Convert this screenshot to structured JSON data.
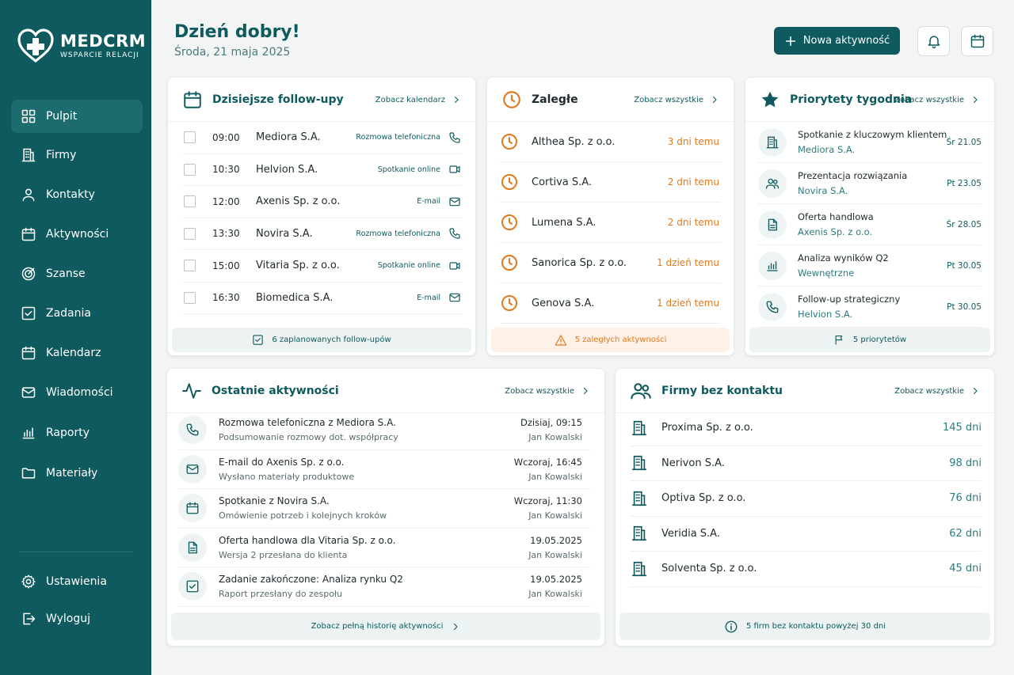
{
  "app": {
    "logo_title": "MEDCRM",
    "logo_subtitle": "WSPARCIE RELACJI",
    "brand_color": "#0e5a5e",
    "accent_orange": "#e07a1f"
  },
  "sidebar": {
    "items": [
      {
        "label": "Pulpit",
        "icon": "dashboard-icon"
      },
      {
        "label": "Firmy",
        "icon": "building-icon"
      },
      {
        "label": "Kontakty",
        "icon": "user-icon"
      },
      {
        "label": "Aktywności",
        "icon": "calendar-icon"
      },
      {
        "label": "Szanse",
        "icon": "target-icon"
      },
      {
        "label": "Zadania",
        "icon": "checkbox-icon"
      },
      {
        "label": "Kalendarz",
        "icon": "calendar-icon"
      },
      {
        "label": "Wiadomości",
        "icon": "mail-icon"
      },
      {
        "label": "Raporty",
        "icon": "bar-chart-icon"
      },
      {
        "label": "Materiały",
        "icon": "folder-icon"
      }
    ],
    "settings_label": "Ustawienia",
    "logout_label": "Wyloguj"
  },
  "header": {
    "greeting": "Dzień dobry!",
    "date": "Środa, 21 maja 2025",
    "new_activity_label": "Nowa aktywność"
  },
  "followups": {
    "title": "Dzisiejsze follow-upy",
    "link": "Zobacz kalendarz",
    "footer": "6 zaplanowanych follow-upów",
    "rows": [
      {
        "time": "09:00",
        "company": "Mediora S.A.",
        "type": "Rozmowa telefoniczna",
        "icon": "phone-icon"
      },
      {
        "time": "10:30",
        "company": "Helvion S.A.",
        "type": "Spotkanie online",
        "icon": "video-icon"
      },
      {
        "time": "12:00",
        "company": "Axenis Sp. z o.o.",
        "type": "E-mail",
        "icon": "mail-icon"
      },
      {
        "time": "13:30",
        "company": "Novira S.A.",
        "type": "Rozmowa telefoniczna",
        "icon": "phone-icon"
      },
      {
        "time": "15:00",
        "company": "Vitaria Sp. z o.o.",
        "type": "Spotkanie online",
        "icon": "video-icon"
      },
      {
        "time": "16:30",
        "company": "Biomedica S.A.",
        "type": "E-mail",
        "icon": "mail-icon"
      }
    ]
  },
  "overdue": {
    "title": "Zaległe",
    "link": "Zobacz wszystkie",
    "footer": "5 zaległych aktywności",
    "rows": [
      {
        "company": "Althea Sp. z o.o.",
        "ago": "3 dni temu"
      },
      {
        "company": "Cortiva S.A.",
        "ago": "2 dni temu"
      },
      {
        "company": "Lumena S.A.",
        "ago": "2 dni temu"
      },
      {
        "company": "Sanorica Sp. z o.o.",
        "ago": "1 dzień temu"
      },
      {
        "company": "Genova S.A.",
        "ago": "1 dzień temu"
      }
    ]
  },
  "priorities": {
    "title": "Priorytety tygodnia",
    "link": "Zobacz wszystkie",
    "footer": "5 priorytetów",
    "rows": [
      {
        "title": "Spotkanie z kluczowym klientem",
        "sub": "Mediora S.A.",
        "date": "Śr 21.05",
        "icon": "building-icon"
      },
      {
        "title": "Prezentacja rozwiązania",
        "sub": "Novira S.A.",
        "date": "Pt 23.05",
        "icon": "users-icon"
      },
      {
        "title": "Oferta handlowa",
        "sub": "Axenis Sp. z o.o.",
        "date": "Śr 28.05",
        "icon": "document-icon"
      },
      {
        "title": "Analiza wyników Q2",
        "sub": "Wewnętrzne",
        "date": "Pt 30.05",
        "icon": "bar-chart-icon"
      },
      {
        "title": "Follow-up strategiczny",
        "sub": "Helvion S.A.",
        "date": "Pt 30.05",
        "icon": "phone-icon"
      }
    ]
  },
  "recent": {
    "title": "Ostatnie aktywności",
    "link": "Zobacz wszystkie",
    "footer": "Zobacz pełną historię aktywności",
    "rows": [
      {
        "title": "Rozmowa telefoniczna z Mediora S.A.",
        "sub": "Podsumowanie rozmowy dot. współpracy",
        "date": "Dzisiaj, 09:15",
        "user": "Jan Kowalski",
        "icon": "phone-icon"
      },
      {
        "title": "E-mail do Axenis Sp. z o.o.",
        "sub": "Wysłano materiały produktowe",
        "date": "Wczoraj, 16:45",
        "user": "Jan Kowalski",
        "icon": "mail-icon"
      },
      {
        "title": "Spotkanie z Novira S.A.",
        "sub": "Omówienie potrzeb i kolejnych kroków",
        "date": "Wczoraj, 11:30",
        "user": "Jan Kowalski",
        "icon": "calendar-icon"
      },
      {
        "title": "Oferta handlowa dla Vitaria Sp. z o.o.",
        "sub": "Wersja 2 przesłana do klienta",
        "date": "19.05.2025",
        "user": "Jan Kowalski",
        "icon": "document-icon"
      },
      {
        "title": "Zadanie zakończone: Analiza rynku Q2",
        "sub": "Raport przesłany do zespołu",
        "date": "19.05.2025",
        "user": "Jan Kowalski",
        "icon": "checkbox-icon"
      }
    ]
  },
  "nocontact": {
    "title": "Firmy bez kontaktu",
    "link": "Zobacz wszystkie",
    "footer": "5 firm bez kontaktu powyżej 30 dni",
    "rows": [
      {
        "company": "Proxima Sp. z o.o.",
        "days": "145 dni"
      },
      {
        "company": "Nerivon S.A.",
        "days": "98 dni"
      },
      {
        "company": "Optiva Sp. z o.o.",
        "days": "76 dni"
      },
      {
        "company": "Veridia S.A.",
        "days": "62 dni"
      },
      {
        "company": "Solventa Sp. z o.o.",
        "days": "45 dni"
      }
    ]
  }
}
